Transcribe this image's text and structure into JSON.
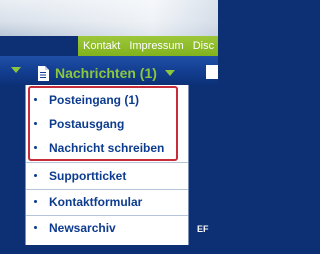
{
  "utility_nav": {
    "links": [
      {
        "label": "Kontakt"
      },
      {
        "label": "Impressum"
      },
      {
        "label": "Disc"
      }
    ]
  },
  "main_nav": {
    "active_item": {
      "label": "Nachrichten (1)",
      "icon": "document-icon"
    }
  },
  "dropdown": {
    "items": [
      {
        "label": "Posteingang (1)"
      },
      {
        "label": "Postausgang"
      },
      {
        "label": "Nachricht schreiben"
      },
      {
        "label": "Supportticket"
      },
      {
        "label": "Kontaktformular"
      },
      {
        "label": "Newsarchiv"
      }
    ]
  },
  "right_partial_text": "EF",
  "colors": {
    "nav_accent_green": "#8cc63f",
    "utility_bar_green": "#8cba2a",
    "nav_bar_blue": "#123d8f",
    "dropdown_text_blue": "#0d3c8f",
    "highlight_red": "#c62d3a"
  }
}
